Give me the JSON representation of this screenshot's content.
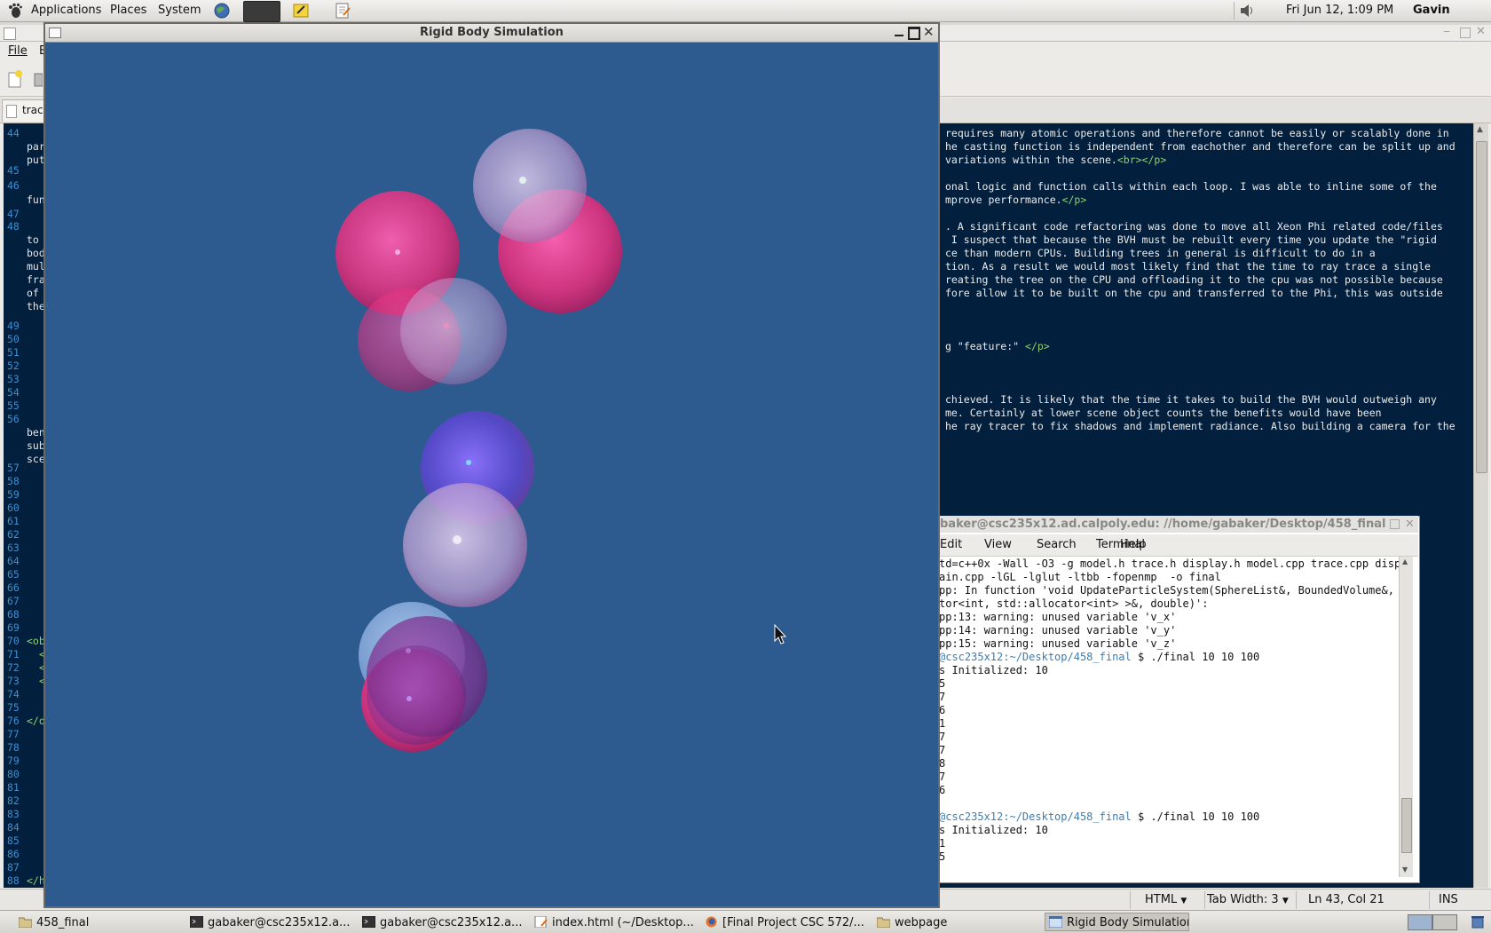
{
  "top_panel": {
    "menus": [
      "Applications",
      "Places",
      "System"
    ],
    "clock": "Fri Jun 12,  1:09 PM",
    "user": "Gavin Baker"
  },
  "gedit": {
    "menu_file": "File",
    "menu_edit": "E",
    "tab_label": "trac",
    "line_numbers": [
      "44",
      "45",
      "46",
      "47",
      "48",
      "49",
      "50",
      "51",
      "52",
      "53",
      "54",
      "55",
      "56",
      "57",
      "58",
      "59",
      "60",
      "61",
      "62",
      "63",
      "64",
      "65",
      "66",
      "67",
      "68",
      "69",
      "70",
      "71",
      "72",
      "73",
      "74",
      "75",
      "76",
      "77",
      "78",
      "79",
      "80",
      "81",
      "82",
      "83",
      "84",
      "85",
      "86",
      "87",
      "88"
    ],
    "left_fragments": [
      "para",
      "put",
      "func",
      "to s",
      "body",
      "mult",
      "fram",
      "of",
      "the",
      "bene",
      "subs",
      "scen",
      "<obj",
      "<",
      "<",
      "<",
      "</ol",
      "</ht"
    ],
    "code_lines": [
      "requires many atomic operations and therefore cannot be easily or scalably done in",
      "he casting function is independent from eachother and therefore can be split up and",
      "variations within the scene.",
      "onal logic and function calls within each loop. I was able to inline some of the",
      "mprove performance.",
      ". A significant code refactoring was done to move all Xeon Phi related code/files",
      " I suspect that because the BVH must be rebuilt every time you update the \"rigid",
      "ce than modern CPUs. Building trees in general is difficult to do in a",
      "tion. As a result we would most likely find that the time to ray trace a single",
      "reating the tree on the CPU and offloading it to the cpu was not possible because",
      "fore allow it to be built on the cpu and transferred to the Phi, this was outside",
      "g \"feature:\" ",
      "chieved. It is likely that the time it takes to build the BVH would outweigh any",
      "me. Certainly at lower scene object counts the benefits would have been",
      "he ray tracer to fix shadows and implement radiance. Also building a camera for the"
    ],
    "code_tags": [
      "<br></p>",
      "</p>",
      "</p>"
    ],
    "status": {
      "language": "HTML",
      "tab_width": "Tab Width:  3",
      "position": "Ln 43, Col 21",
      "mode": "INS"
    }
  },
  "sim_window": {
    "title": "Rigid Body Simulation"
  },
  "terminal": {
    "title": "baker@csc235x12.ad.calpoly.edu: //home/gabaker/Desktop/458_final",
    "menus": [
      "Edit",
      "View",
      "Search",
      "Terminal",
      "Help"
    ],
    "lines": [
      "td=c++0x -Wall -O3 -g model.h trace.h display.h model.cpp trace.cpp displa",
      "ain.cpp -lGL -lglut -ltbb -fopenmp  -o final",
      "pp: In function 'void UpdateParticleSystem(SphereList&, BoundedVolume&, s",
      "tor<int, std::allocator<int> >&, double)':",
      "pp:13: warning: unused variable 'v_x'",
      "pp:14: warning: unused variable 'v_y'",
      "pp:15: warning: unused variable 'v_z'"
    ],
    "prompt_user": "@csc235x12",
    "prompt_path": ":~/Desktop/458_final",
    "command": " $ ./final 10 10 100",
    "init_line": "s Initialized: 10",
    "digit_column": [
      "5",
      "7",
      "6",
      "1",
      "7",
      "7",
      "8",
      "7",
      "6"
    ],
    "digit_column_2": [
      "1",
      "5"
    ]
  },
  "taskbar": {
    "items": [
      {
        "label": "458_final",
        "icon": "folder-icon"
      },
      {
        "label": "gabaker@csc235x12.a...",
        "icon": "terminal-icon"
      },
      {
        "label": "gabaker@csc235x12.a...",
        "icon": "terminal-icon"
      },
      {
        "label": "index.html (~/Desktop...",
        "icon": "text-editor-icon"
      },
      {
        "label": "[Final Project CSC 572/...",
        "icon": "firefox-icon"
      },
      {
        "label": "webpage",
        "icon": "folder-icon"
      },
      {
        "label": "Rigid Body Simulation",
        "icon": "window-icon"
      }
    ],
    "active_index": 6
  },
  "colors": {
    "sim_background": "#2d5b8f",
    "editor_background": "#02203d",
    "line_number": "#3f8fd1",
    "html_tag": "#8fd36a",
    "prompt": "#3c7db3"
  }
}
